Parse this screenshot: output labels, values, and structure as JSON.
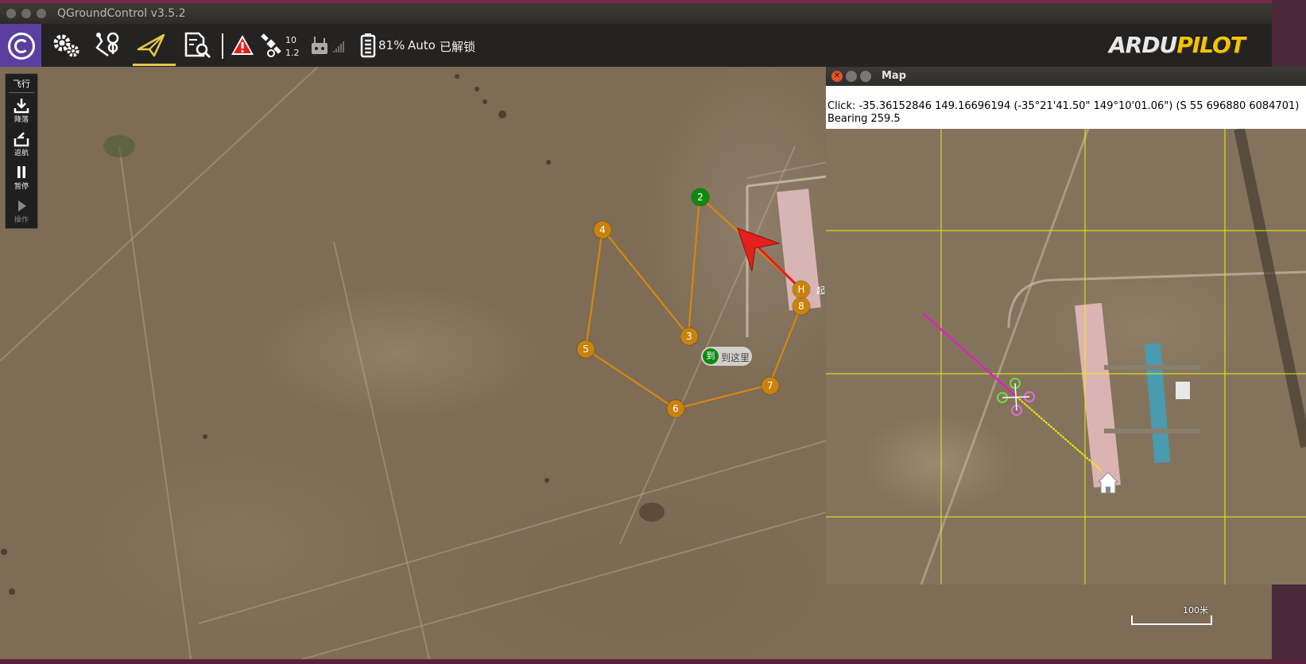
{
  "window": {
    "title": "QGroundControl v3.5.2"
  },
  "toolbar": {
    "tabs": [
      {
        "id": "settings",
        "icon": "gear-icon"
      },
      {
        "id": "plan",
        "icon": "plan-route-icon"
      },
      {
        "id": "fly",
        "icon": "paper-plane-icon",
        "active": true
      },
      {
        "id": "analyze",
        "icon": "analyze-document-icon"
      }
    ],
    "gps_sat_count": "10",
    "gps_hdop": "1.2",
    "battery": "81%",
    "flight_mode": "Auto",
    "arm_status": "已解锁",
    "logo_ardu": "ARDU",
    "logo_pilot": "PILOT"
  },
  "toolstrip": {
    "title": "飞行",
    "items": [
      {
        "label": "降落",
        "icon": "land-icon",
        "enabled": true
      },
      {
        "label": "返航",
        "icon": "rtl-icon",
        "enabled": true
      },
      {
        "label": "暂停",
        "icon": "pause-icon",
        "enabled": true
      },
      {
        "label": "操作",
        "icon": "play-icon",
        "enabled": false
      }
    ]
  },
  "mission": {
    "waypoints": [
      "2",
      "3",
      "4",
      "5",
      "6",
      "7",
      "8"
    ],
    "current_waypoint": "2",
    "home_label": "H",
    "takeoff_label": "起",
    "goto_short": "到",
    "goto_label": "到这里"
  },
  "scale": {
    "label": "100米"
  },
  "map_window": {
    "title": "Map",
    "click_text": "Click: -35.36152846 149.16696194 (-35°21'41.50\" 149°10'01.06\") (S 55 696880 6084701)",
    "bearing_text": "Bearing 259.5"
  },
  "colors": {
    "waypoint": "#c8820d",
    "current_waypoint": "#0f8a0f",
    "vehicle": "#e3201e",
    "grid": "#f0f000",
    "trail": "#e020c0"
  }
}
